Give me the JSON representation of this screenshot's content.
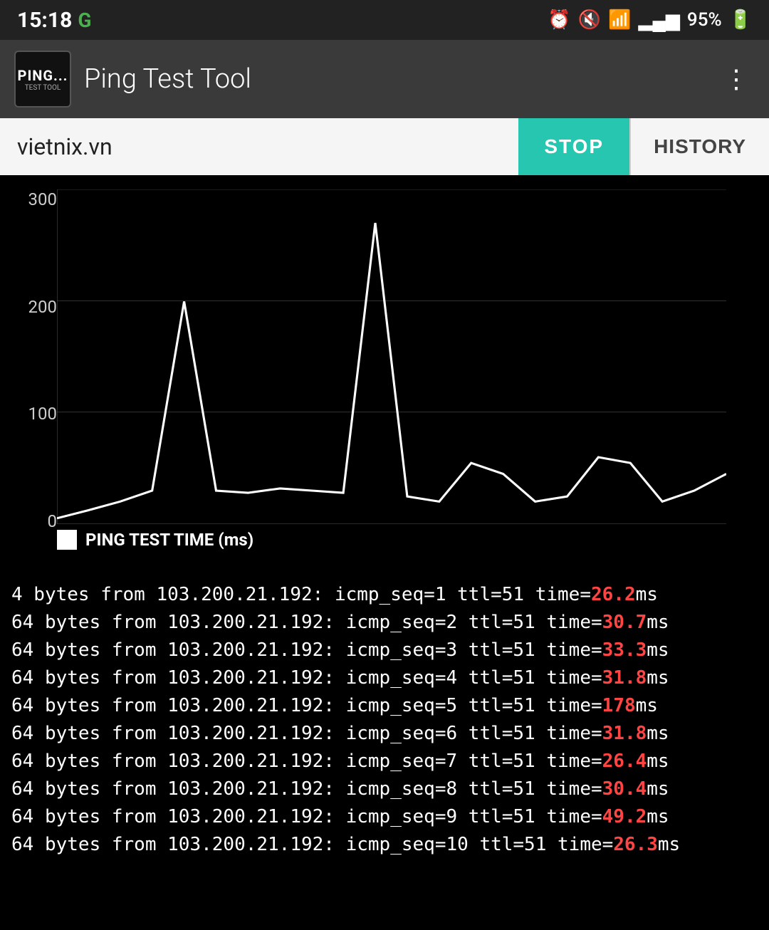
{
  "statusBar": {
    "time": "15:18",
    "network": "G",
    "battery": "95%",
    "icons": [
      "alarm",
      "mute",
      "wifi",
      "signal1",
      "signal2",
      "battery"
    ]
  },
  "header": {
    "appName": "Ping Test Tool",
    "iconText": "PING...",
    "iconSub": "TEST TOOL"
  },
  "toolbar": {
    "host": "vietnix.vn",
    "stopLabel": "STOP",
    "historyLabel": "HISTORY"
  },
  "chart": {
    "yLabels": [
      "300",
      "200",
      "100",
      "0"
    ],
    "legendText": "PING TEST TIME (ms)",
    "dataPoints": [
      5,
      12,
      20,
      30,
      170,
      30,
      28,
      32,
      30,
      28,
      270,
      25,
      20,
      55,
      45,
      20,
      25,
      60,
      55,
      20,
      30,
      45
    ]
  },
  "log": {
    "prefix": "64 bytes from 103.200.21.192:",
    "lines": [
      {
        "seq": 1,
        "ttl": 51,
        "time": "26.2",
        "partial": true
      },
      {
        "seq": 2,
        "ttl": 51,
        "time": "30.7",
        "partial": false
      },
      {
        "seq": 3,
        "ttl": 51,
        "time": "33.3",
        "partial": false
      },
      {
        "seq": 4,
        "ttl": 51,
        "time": "31.8",
        "partial": false
      },
      {
        "seq": 5,
        "ttl": 51,
        "time": "178",
        "partial": false
      },
      {
        "seq": 6,
        "ttl": 51,
        "time": "31.8",
        "partial": false
      },
      {
        "seq": 7,
        "ttl": 51,
        "time": "26.4",
        "partial": false
      },
      {
        "seq": 8,
        "ttl": 51,
        "time": "30.4",
        "partial": false
      },
      {
        "seq": 9,
        "ttl": 51,
        "time": "49.2",
        "partial": false
      },
      {
        "seq": 10,
        "ttl": 51,
        "time": "26.3",
        "partial": false
      }
    ]
  },
  "colors": {
    "stopBg": "#26c6b0",
    "logTime": "#ff4444",
    "chartLine": "#ffffff",
    "chartBg": "#000000",
    "headerBg": "#3a3a3a",
    "statusBg": "#222222"
  }
}
